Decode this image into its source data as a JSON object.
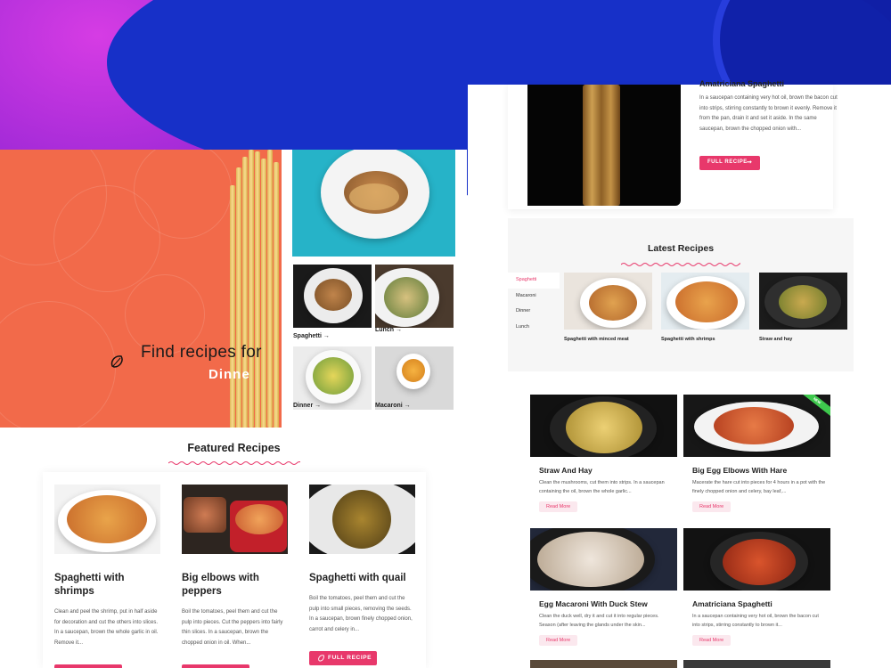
{
  "hero": {
    "find_text": "Find recipes for",
    "rotating_word": "Dinne"
  },
  "gallery": {
    "tiles": [
      {
        "label": "Spaghetti →"
      },
      {
        "label": "Lunch →"
      },
      {
        "label": "Dinner →"
      },
      {
        "label": "Macaroni →"
      }
    ]
  },
  "featured": {
    "title": "Featured Recipes",
    "cards": [
      {
        "title": "Spaghetti with shrimps",
        "desc": "Clean and peel the shrimp, put in half aside for decoration and cut the others into slices.  In a saucepan, brown the whole garlic in oil.  Remove it..."
      },
      {
        "title": "Big elbows with peppers",
        "desc": "Boil the tomatoes, peel them and cut the pulp into pieces. Cut the peppers into fairly thin slices. In a saucepan, brown the chopped onion in oil. When..."
      },
      {
        "title": "Spaghetti with quail",
        "desc": "Boil the tomatoes, peel them and cut the pulp into small pieces, removing the seeds.  In a saucepan, brown finely chopped onion, carrot and celery in..."
      }
    ],
    "button_label": "FULL RECIPE"
  },
  "top_recipe": {
    "title": "Amatriciana Spaghetti",
    "desc": "In a saucepan containing very hot oil, brown the bacon cut into strips, stirring constantly to brown it evenly.  Remove it from the pan, drain it and set it aside.  In the same saucepan, brown the chopped onion with...",
    "button_label": "FULL RECIPE",
    "button_arrow": "➞"
  },
  "latest": {
    "title": "Latest Recipes",
    "tabs": [
      "Spaghetti",
      "Macaroni",
      "Dinner",
      "Lunch"
    ],
    "active_tab": "Spaghetti",
    "cards": [
      {
        "caption": "Spaghetti with minced meat"
      },
      {
        "caption": "Spaghetti with shrimps"
      },
      {
        "caption": "Straw and hay"
      }
    ]
  },
  "recipes": {
    "read_more": "Read More",
    "ribbon": "NEW",
    "items": [
      {
        "title": "Straw And Hay",
        "desc": "Clean the mushrooms, cut them into strips. In a saucepan containing the oil, brown the whole garlic..."
      },
      {
        "title": "Big Egg Elbows With Hare",
        "desc": "Macerate the hare cut into pieces for 4 hours in a pot with the finely chopped onion and celery, bay leaf,..."
      },
      {
        "title": "Egg Macaroni With Duck Stew",
        "desc": "Clean the duck well, dry it and cut it into regular pieces. Season (after leaving the glands under the skin..."
      },
      {
        "title": "Amatriciana Spaghetti",
        "desc": "In a saucepan containing very hot oil, brown the bacon cut into strips, stirring constantly to brown it..."
      }
    ]
  },
  "colors": {
    "accent": "#e8386b",
    "hero_orange": "#f26a4a",
    "feature_teal": "#26b3c8",
    "banner_purple": "#a52bd8",
    "banner_blue": "#1730c8"
  }
}
